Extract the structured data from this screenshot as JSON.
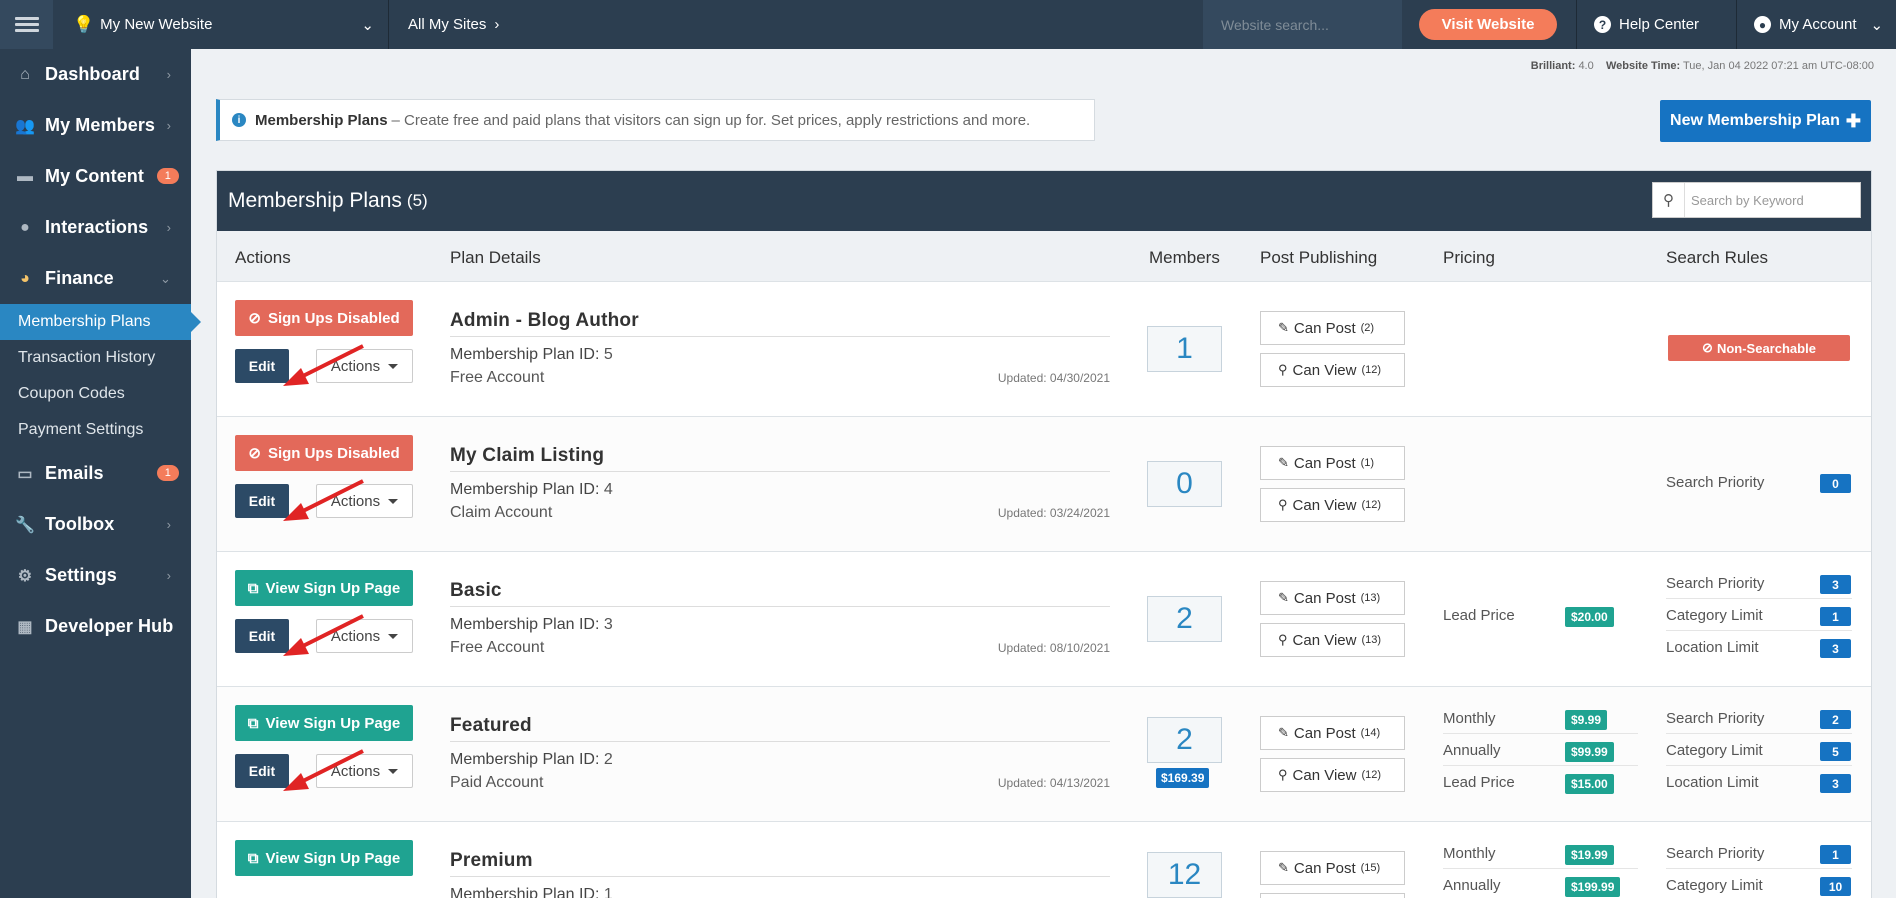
{
  "topbar": {
    "site_name": "My New Website",
    "all_sites": "All My Sites",
    "search_placeholder": "Website search...",
    "visit": "Visit Website",
    "help": "Help Center",
    "account": "My Account"
  },
  "sidebar": {
    "items": [
      {
        "label": "Dashboard",
        "icon": "home-icon"
      },
      {
        "label": "My Members",
        "icon": "users-icon"
      },
      {
        "label": "My Content",
        "icon": "folder-icon",
        "badge": "1"
      },
      {
        "label": "Interactions",
        "icon": "chat-icon"
      },
      {
        "label": "Finance",
        "icon": "pie-chart-icon"
      },
      {
        "label": "Emails",
        "icon": "inbox-icon",
        "badge": "1"
      },
      {
        "label": "Toolbox",
        "icon": "wrench-icon"
      },
      {
        "label": "Settings",
        "icon": "gear-icon"
      },
      {
        "label": "Developer Hub",
        "icon": "grid-icon"
      }
    ],
    "finance_sub": [
      "Membership Plans",
      "Transaction History",
      "Coupon Codes",
      "Payment Settings"
    ]
  },
  "meta": {
    "version_label": "Brilliant:",
    "version": "4.0",
    "time_label": "Website Time:",
    "time": "Tue, Jan 04 2022 07:21 am UTC-08:00"
  },
  "intro": {
    "title": "Membership Plans",
    "text": "– Create free and paid plans that visitors can sign up for. Set prices, apply restrictions and more."
  },
  "new_plan_button": "New Membership Plan",
  "panel": {
    "title": "Membership Plans",
    "count": "(5)",
    "search_placeholder": "Search by Keyword"
  },
  "columns": [
    "Actions",
    "Plan Details",
    "Members",
    "Post Publishing",
    "Pricing",
    "Search Rules"
  ],
  "labels": {
    "edit": "Edit",
    "actions": "Actions",
    "plan_id": "Membership Plan ID:",
    "can_post": "Can Post",
    "can_view": "Can View"
  },
  "plans": [
    {
      "status": "Sign Ups Disabled",
      "name": "Admin - Blog Author",
      "id": "5",
      "type": "Free Account",
      "updated": "Updated: 04/30/2021",
      "members": "1",
      "can_post": "(2)",
      "can_view": "(12)",
      "search_badge": "Non-Searchable"
    },
    {
      "status": "Sign Ups Disabled",
      "name": "My Claim Listing",
      "id": "4",
      "type": "Claim Account",
      "updated": "Updated: 03/24/2021",
      "members": "0",
      "can_post": "(1)",
      "can_view": "(12)",
      "search": [
        {
          "label": "Search Priority",
          "value": "0"
        }
      ]
    },
    {
      "status": "View Sign Up Page",
      "name": "Basic",
      "id": "3",
      "type": "Free Account",
      "updated": "Updated: 08/10/2021",
      "members": "2",
      "can_post": "(13)",
      "can_view": "(13)",
      "pricing": [
        {
          "label": "Lead Price",
          "value": "$20.00"
        }
      ],
      "search": [
        {
          "label": "Search Priority",
          "value": "3"
        },
        {
          "label": "Category Limit",
          "value": "1"
        },
        {
          "label": "Location Limit",
          "value": "3"
        }
      ]
    },
    {
      "status": "View Sign Up Page",
      "name": "Featured",
      "id": "2",
      "type": "Paid Account",
      "updated": "Updated: 04/13/2021",
      "members": "2",
      "member_value": "$169.39",
      "can_post": "(14)",
      "can_view": "(12)",
      "pricing": [
        {
          "label": "Monthly",
          "value": "$9.99"
        },
        {
          "label": "Annually",
          "value": "$99.99"
        },
        {
          "label": "Lead Price",
          "value": "$15.00"
        }
      ],
      "search": [
        {
          "label": "Search Priority",
          "value": "2"
        },
        {
          "label": "Category Limit",
          "value": "5"
        },
        {
          "label": "Location Limit",
          "value": "3"
        }
      ]
    },
    {
      "status": "View Sign Up Page",
      "name": "Premium",
      "id": "1",
      "members": "12",
      "can_post": "(15)",
      "pricing": [
        {
          "label": "Monthly",
          "value": "$19.99"
        },
        {
          "label": "Annually",
          "value": "$199.99"
        }
      ],
      "search": [
        {
          "label": "Search Priority",
          "value": "1"
        },
        {
          "label": "Category Limit",
          "value": "10"
        }
      ]
    }
  ],
  "colors": {
    "topbar": "#2c3e50",
    "accent": "#2a87c2",
    "primary": "#1673c2",
    "danger": "#e3695a",
    "success": "#1fa391",
    "visit": "#f47c5a",
    "annotation_arrow": "#e02424"
  }
}
